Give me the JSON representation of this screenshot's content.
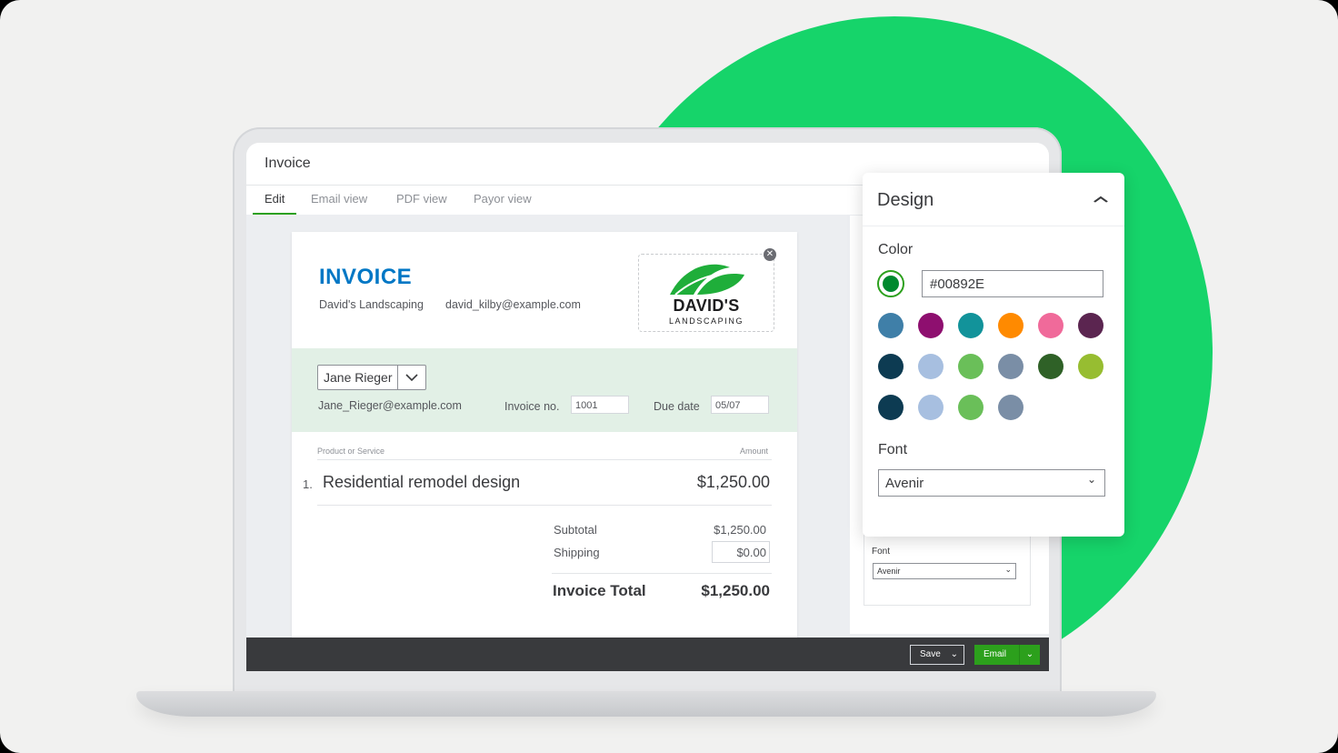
{
  "app": {
    "title": "Invoice"
  },
  "tabs": [
    {
      "label": "Edit",
      "active": true
    },
    {
      "label": "Email view"
    },
    {
      "label": "PDF view"
    },
    {
      "label": "Payor view"
    }
  ],
  "invoice": {
    "heading": "INVOICE",
    "company": "David's Landscaping",
    "company_email": "david_kilby@example.com",
    "logo": {
      "brand": "DAVID'S",
      "sub": "LANDSCAPING",
      "close_icon": "close-icon"
    },
    "customer": {
      "name": "Jane Rieger",
      "email": "Jane_Rieger@example.com",
      "invoice_no_label": "Invoice no.",
      "invoice_no": "1001",
      "due_date_label": "Due date",
      "due_date": "05/07"
    },
    "columns": {
      "product": "Product or Service",
      "amount": "Amount"
    },
    "lines": [
      {
        "num": "1.",
        "description": "Residential remodel design",
        "amount": "$1,250.00"
      }
    ],
    "subtotal_label": "Subtotal",
    "subtotal": "$1,250.00",
    "shipping_label": "Shipping",
    "shipping": "$0.00",
    "total_label": "Invoice Total",
    "total": "$1,250.00"
  },
  "side_panel": {
    "font_label": "Font",
    "font_value": "Avenir"
  },
  "footer": {
    "save_label": "Save",
    "email_label": "Email"
  },
  "design": {
    "title": "Design",
    "color_label": "Color",
    "selected_color": "#00892E",
    "swatches": [
      "#3f7fa8",
      "#8e0f6f",
      "#12939a",
      "#ff8a00",
      "#f06a9a",
      "#5b2550",
      "#0d3b52",
      "#a7bfe0",
      "#6abf59",
      "#7a8ea6",
      "#2f6127",
      "#97bd31",
      "#0d3b52",
      "#a7bfe0",
      "#6abf59",
      "#7a8ea6"
    ],
    "font_label": "Font",
    "font_value": "Avenir"
  },
  "colors": {
    "accent_green": "#2ca01c",
    "invoice_blue": "#0077c5",
    "background_green": "#16d46a"
  }
}
